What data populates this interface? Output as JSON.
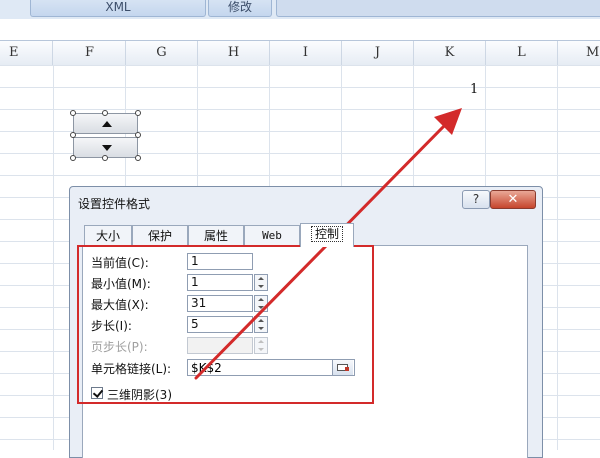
{
  "ribbon": {
    "xml_label": "XML",
    "modify_label": "修改"
  },
  "columns": [
    "E",
    "F",
    "G",
    "H",
    "I",
    "J",
    "K",
    "L",
    "M"
  ],
  "sheet": {
    "k2_value": "1"
  },
  "dialog": {
    "title": "设置控件格式",
    "help_label": "?",
    "close_label": "✕",
    "tabs": [
      "大小",
      "保护",
      "属性",
      "Web",
      "控制"
    ],
    "active_tab": "控制",
    "fields": {
      "current_label": "当前值(C):",
      "current_value": "1",
      "min_label": "最小值(M):",
      "min_value": "1",
      "max_label": "最大值(X):",
      "max_value": "31",
      "step_label": "步长(I):",
      "step_value": "5",
      "page_step_label": "页步长(P):",
      "page_step_value": "",
      "cell_link_label": "单元格链接(L):",
      "cell_link_value": "$K$2",
      "shading_label": "三维阴影(3)",
      "shading_checked": true
    }
  },
  "colors": {
    "highlight": "#d32a2a",
    "arrow": "#d32a2a"
  }
}
